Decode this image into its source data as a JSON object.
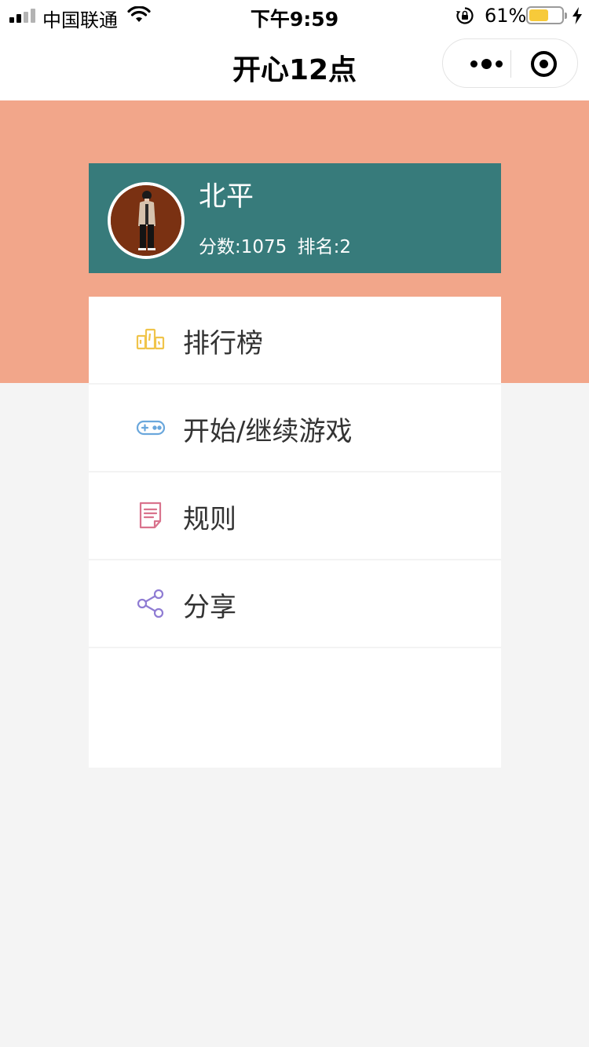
{
  "status_bar": {
    "carrier": "中国联通",
    "time": "下午9:59",
    "battery_percent_label": "61%",
    "battery_level": 0.61
  },
  "nav": {
    "title": "开心12点"
  },
  "colors": {
    "banner": "#f2a68a",
    "card": "#377b7b",
    "leaderboard_icon": "#f0c44a",
    "game_icon": "#6aa7dc",
    "rules_icon": "#d9738d",
    "share_icon": "#8f7cd3"
  },
  "profile": {
    "name": "北平",
    "score_text": "分数:1075",
    "rank_text": "排名:2"
  },
  "menu": {
    "items": [
      {
        "label": "排行榜",
        "icon": "leaderboard-icon"
      },
      {
        "label": "开始/继续游戏",
        "icon": "gamepad-icon"
      },
      {
        "label": "规则",
        "icon": "document-icon"
      },
      {
        "label": "分享",
        "icon": "share-icon"
      }
    ]
  }
}
